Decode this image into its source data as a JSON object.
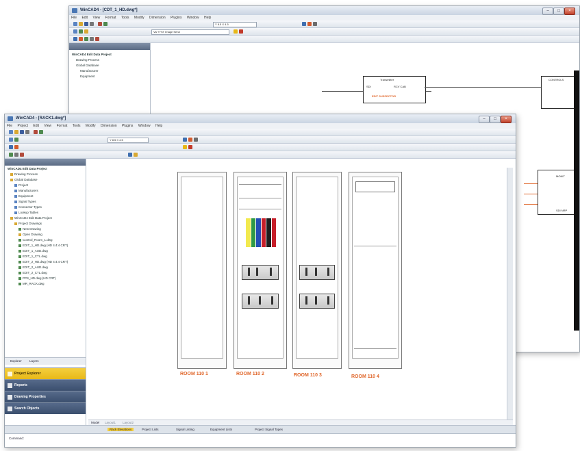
{
  "back_window": {
    "title": "WinCAD4 - [CDT_1_HD.dwg*]",
    "menu": [
      "File",
      "Edit",
      "View",
      "Format",
      "Tools",
      "Modify",
      "Dimension",
      "Plugins",
      "Window",
      "Help"
    ],
    "toolbar_zoom": "Y 8.5 X 4.5",
    "layer_field": "VA TYST Image Send",
    "panel_title": "WinCAD4 Edit Data Project",
    "tree": [
      "Drawing Process",
      "Global Database",
      "Manufacturer",
      "Equipment"
    ],
    "diagram_labels": [
      "Transmitter",
      "RCV CAB",
      "SDI",
      "EDIT SUSPECTOR",
      "CONTROLS",
      "MONIT",
      "SDI NRP"
    ]
  },
  "front_window": {
    "title": "WinCAD4 - [RACK1.dwg*]",
    "menu": [
      "File",
      "Project",
      "Edit",
      "View",
      "Format",
      "Tools",
      "Modify",
      "Dimension",
      "Plugins",
      "Window",
      "Help"
    ],
    "toolbar_zoom": "Y 8.5 X 4.5",
    "panel_title": "WinCAD4 Edit Data Project",
    "tree": [
      {
        "label": "WinCAD4 Edit Data Project",
        "indent": 0
      },
      {
        "label": "Drawing Process",
        "indent": 1
      },
      {
        "label": "Global Database",
        "indent": 1
      },
      {
        "label": "Project",
        "indent": 2
      },
      {
        "label": "Manufacturers",
        "indent": 2
      },
      {
        "label": "Equipment",
        "indent": 2
      },
      {
        "label": "Signal Types",
        "indent": 2
      },
      {
        "label": "Connector Types",
        "indent": 2
      },
      {
        "label": "Lookup Tables",
        "indent": 2
      },
      {
        "label": "WinCAD4 Edit Data Project",
        "indent": 1
      },
      {
        "label": "Project Drawings",
        "indent": 2
      },
      {
        "label": "New Drawing",
        "indent": 3
      },
      {
        "label": "Open Drawing",
        "indent": 3
      },
      {
        "label": "Control_Room_1.dwg",
        "indent": 3
      },
      {
        "label": "EDIT_1_HD.dwg (HD 4:4:4 CRT)",
        "indent": 3
      },
      {
        "label": "EDIT_1_AUD.dwg",
        "indent": 3
      },
      {
        "label": "EDIT_1_CTL.dwg",
        "indent": 3
      },
      {
        "label": "EDIT_2_HD.dwg (HD 4:4:4 CRT)",
        "indent": 3
      },
      {
        "label": "EDIT_2_AUD.dwg",
        "indent": 3
      },
      {
        "label": "EDIT_2_CTL.dwg",
        "indent": 3
      },
      {
        "label": "PPS_HD.dwg (HD CRT)",
        "indent": 3
      },
      {
        "label": "MR_RACK.dwg",
        "indent": 3
      }
    ],
    "panel_tabs": [
      "Explorer",
      "Layers"
    ],
    "nav_buttons": [
      {
        "label": "Project Explorer",
        "color": "#e8b818"
      },
      {
        "label": "Reports",
        "color": "#3b4f6e"
      },
      {
        "label": "Drawing Properties",
        "color": "#3b4f6e"
      },
      {
        "label": "Search Objects",
        "color": "#3b4f6e"
      }
    ],
    "racks": [
      "ROOM 110 1",
      "ROOM 110 2",
      "ROOM 110 3",
      "ROOM 110 4"
    ],
    "sheet_tabs": [
      "Model",
      "Layout1",
      "Layout2"
    ],
    "status_tabs": [
      "Rack Elevations",
      "Project Lists",
      "Signal Listing",
      "Equipment Lists",
      "Project Signal Types"
    ],
    "command_label": "Command:",
    "colors": {
      "accent_orange": "#e0662a",
      "nav_yellow": "#e8b818",
      "nav_dark": "#3b4f6e",
      "titlebar_blue": "#c9d4e2"
    }
  }
}
